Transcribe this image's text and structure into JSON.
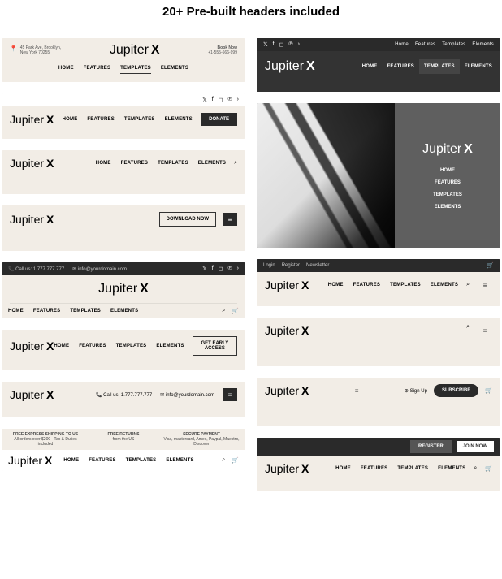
{
  "title": "20+ Pre-built headers included",
  "logo": "Jupiter",
  "logo_x": "X",
  "nav": {
    "home": "HOME",
    "features": "FEATURES",
    "templates": "TEMPLATES",
    "elements": "ELEMENTS"
  },
  "top_nav_small": {
    "home": "Home",
    "features": "Features",
    "templates": "Templates",
    "elements": "Elements"
  },
  "h1": {
    "addr1": "45 Park Ave, Brooklyn,",
    "addr2": "New York 70255",
    "book": "Book Now",
    "phone": "+1-555-666-999"
  },
  "h5": {
    "call": "Call us: 1.777.777.777",
    "email": "info@yourdomain.com"
  },
  "buttons": {
    "donate": "DONATE",
    "download": "DOWNLOAD NOW",
    "early": "GET EARLY ACCESS",
    "subscribe": "SUBSCRIBE",
    "signup": "Sign Up",
    "register": "REGISTER",
    "join": "JOIN NOW"
  },
  "links": {
    "login": "Login",
    "register": "Register",
    "newsletter": "Newsletter"
  },
  "tri": {
    "a_t": "FREE EXPRESS SHIPPING TO US",
    "a_s": "All orders over $200 - Tax & Duties included",
    "b_t": "FREE RETURNS",
    "b_s": "from the US",
    "c_t": "SECURE PAYMENT",
    "c_s": "Visa, mastercard, Amex, Paypal, Maestro, Discover"
  }
}
